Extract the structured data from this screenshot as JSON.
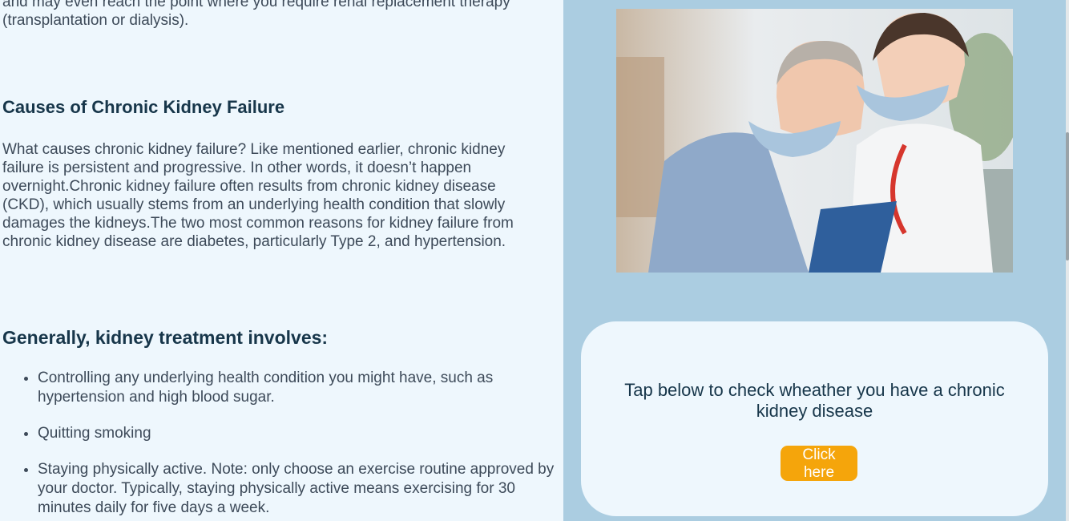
{
  "main": {
    "intro": "and may even reach the point where you require renal replacement therapy (transplantation or dialysis).",
    "causes": {
      "heading": "Causes of Chronic Kidney Failure",
      "paragraph": "What causes chronic kidney failure? Like mentioned earlier, chronic kidney failure is persistent and progressive. In other words, it doesn’t happen overnight.Chronic kidney failure often results from chronic kidney disease (CKD), which usually stems from an underlying health condition that slowly damages the kidneys.The two most common reasons for kidney failure from chronic kidney disease are diabetes, particularly Type 2, and hypertension."
    },
    "treatment": {
      "heading": "Generally, kidney treatment involves:",
      "items": [
        "Controlling any underlying health condition you might have, such as hypertension and high blood sugar.",
        "Quitting smoking",
        "Staying physically active. Note: only choose an exercise routine approved by your doctor. Typically, staying physically active means exercising for 30 minutes daily for five days a week."
      ]
    }
  },
  "sidebar": {
    "cta_text": "Tap below to check wheather you have a chronic kidney disease",
    "cta_button": "Click here"
  },
  "colors": {
    "page_bg": "#eef7fd",
    "sidebar_bg": "#abcde1",
    "heading": "#17364a",
    "body_text": "#3d4a59",
    "button_bg": "#f5a50b"
  }
}
